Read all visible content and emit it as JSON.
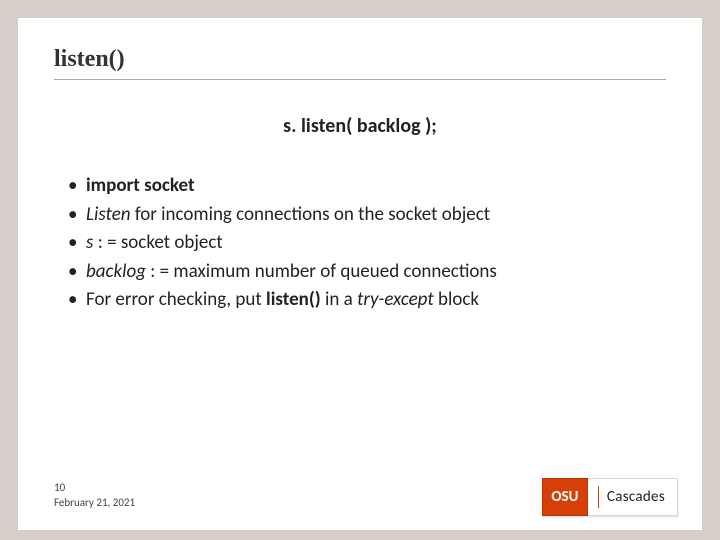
{
  "title": "listen()",
  "code_line": "s. listen( backlog );",
  "bullets": [
    {
      "parts": [
        {
          "text": "import socket",
          "bold": true
        }
      ]
    },
    {
      "parts": [
        {
          "text": "Listen",
          "italic": true
        },
        {
          "text": " for incoming connections on the socket object"
        }
      ]
    },
    {
      "parts": [
        {
          "text": "s",
          "italic": true
        },
        {
          "text": " : = socket object"
        }
      ]
    },
    {
      "parts": [
        {
          "text": "backlog",
          "italic": true
        },
        {
          "text": " : = maximum number of queued connections"
        }
      ]
    },
    {
      "parts": [
        {
          "text": "For error checking, put "
        },
        {
          "text": "listen()",
          "bold": true
        },
        {
          "text": " in a "
        },
        {
          "text": "try-except",
          "italic": true
        },
        {
          "text": " block"
        }
      ]
    }
  ],
  "footer": {
    "page": "10",
    "date": "February 21, 2021"
  },
  "logo": {
    "badge": "OSU",
    "name": "Cascades"
  }
}
